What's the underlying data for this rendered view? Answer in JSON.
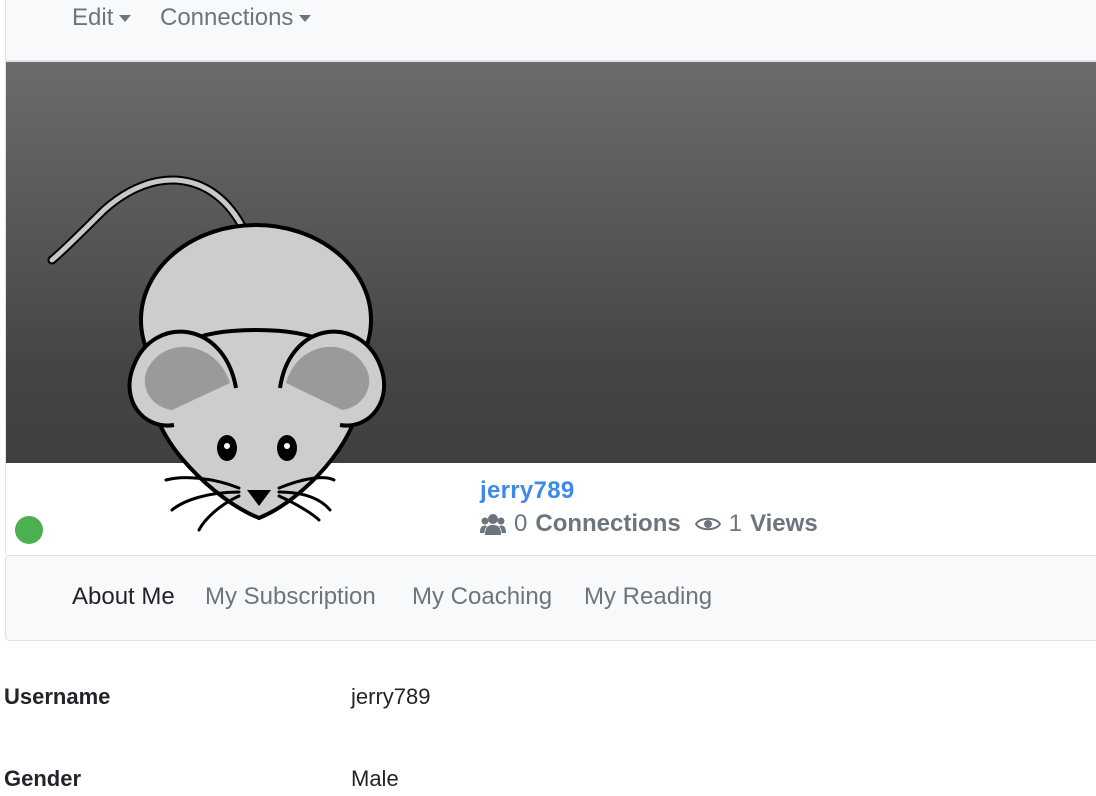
{
  "topbar": {
    "edit_label": "Edit",
    "connections_label": "Connections"
  },
  "profile": {
    "username": "jerry789",
    "connections_count": "0",
    "connections_label": "Connections",
    "views_count": "1",
    "views_label": "Views",
    "online_color": "#4caf50",
    "link_color": "#3d8be6"
  },
  "tabs": [
    {
      "label": "About Me",
      "active": true
    },
    {
      "label": "My Subscription",
      "active": false
    },
    {
      "label": "My Coaching",
      "active": false
    },
    {
      "label": "My Reading",
      "active": false
    }
  ],
  "about": [
    {
      "label": "Username",
      "value": "jerry789"
    },
    {
      "label": "Gender",
      "value": "Male"
    }
  ],
  "icons": {
    "caret": "caret-down-icon",
    "users": "users-icon",
    "eye": "eye-icon"
  }
}
